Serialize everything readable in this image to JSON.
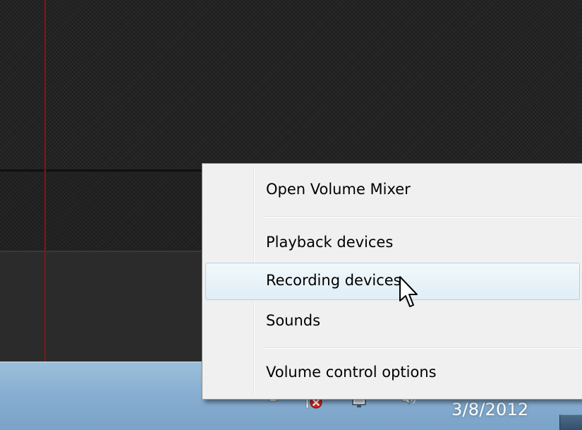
{
  "context_menu": {
    "items": [
      {
        "label": "Open Volume Mixer"
      },
      {
        "label": "Playback devices"
      },
      {
        "label": "Recording devices",
        "highlighted": true
      },
      {
        "label": "Sounds"
      },
      {
        "label": "Volume control options"
      }
    ]
  },
  "taskbar": {
    "clock_date": "3/8/2012",
    "tray_icons": [
      "show-hidden-icons-arrow",
      "network-error-icon",
      "action-center-monitor-icon",
      "speaker-volume-icon"
    ]
  },
  "colors": {
    "menu_highlight_border": "#a8d8eb",
    "taskbar": "#86add0",
    "red_line": "#8b1212"
  }
}
